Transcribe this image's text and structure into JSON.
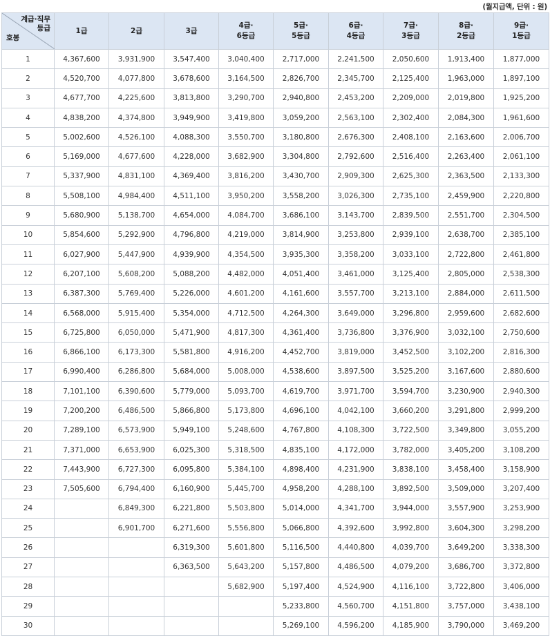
{
  "note": "(월지급액, 단위 : 원)",
  "corner": {
    "top_line1": "계급·직무",
    "top_line2": "등급",
    "bottom": "호봉"
  },
  "columns": [
    [
      "1급"
    ],
    [
      "2급"
    ],
    [
      "3급"
    ],
    [
      "4급·",
      "6등급"
    ],
    [
      "5급·",
      "5등급"
    ],
    [
      "6급·",
      "4등급"
    ],
    [
      "7급·",
      "3등급"
    ],
    [
      "8급·",
      "2등급"
    ],
    [
      "9급·",
      "1등급"
    ]
  ],
  "rows": [
    [
      "1",
      "4,367,600",
      "3,931,900",
      "3,547,400",
      "3,040,400",
      "2,717,000",
      "2,241,500",
      "2,050,600",
      "1,913,400",
      "1,877,000"
    ],
    [
      "2",
      "4,520,700",
      "4,077,800",
      "3,678,600",
      "3,164,500",
      "2,826,700",
      "2,345,700",
      "2,125,400",
      "1,963,000",
      "1,897,100"
    ],
    [
      "3",
      "4,677,700",
      "4,225,600",
      "3,813,800",
      "3,290,700",
      "2,940,800",
      "2,453,200",
      "2,209,000",
      "2,019,800",
      "1,925,200"
    ],
    [
      "4",
      "4,838,200",
      "4,374,800",
      "3,949,900",
      "3,419,800",
      "3,059,200",
      "2,563,100",
      "2,302,400",
      "2,084,300",
      "1,961,600"
    ],
    [
      "5",
      "5,002,600",
      "4,526,100",
      "4,088,300",
      "3,550,700",
      "3,180,800",
      "2,676,300",
      "2,408,100",
      "2,163,600",
      "2,006,700"
    ],
    [
      "6",
      "5,169,000",
      "4,677,600",
      "4,228,000",
      "3,682,900",
      "3,304,800",
      "2,792,600",
      "2,516,400",
      "2,263,400",
      "2,061,100"
    ],
    [
      "7",
      "5,337,900",
      "4,831,100",
      "4,369,400",
      "3,816,200",
      "3,430,700",
      "2,909,300",
      "2,625,300",
      "2,363,500",
      "2,133,300"
    ],
    [
      "8",
      "5,508,100",
      "4,984,400",
      "4,511,100",
      "3,950,200",
      "3,558,200",
      "3,026,300",
      "2,735,100",
      "2,459,900",
      "2,220,800"
    ],
    [
      "9",
      "5,680,900",
      "5,138,700",
      "4,654,000",
      "4,084,700",
      "3,686,100",
      "3,143,700",
      "2,839,500",
      "2,551,700",
      "2,304,500"
    ],
    [
      "10",
      "5,854,600",
      "5,292,900",
      "4,796,800",
      "4,219,000",
      "3,814,900",
      "3,253,800",
      "2,939,100",
      "2,638,700",
      "2,385,100"
    ],
    [
      "11",
      "6,027,900",
      "5,447,900",
      "4,939,900",
      "4,354,500",
      "3,935,300",
      "3,358,200",
      "3,033,100",
      "2,722,800",
      "2,461,800"
    ],
    [
      "12",
      "6,207,100",
      "5,608,200",
      "5,088,200",
      "4,482,000",
      "4,051,400",
      "3,461,000",
      "3,125,400",
      "2,805,000",
      "2,538,300"
    ],
    [
      "13",
      "6,387,300",
      "5,769,400",
      "5,226,000",
      "4,601,200",
      "4,161,600",
      "3,557,700",
      "3,213,100",
      "2,884,000",
      "2,611,500"
    ],
    [
      "14",
      "6,568,000",
      "5,915,400",
      "5,354,000",
      "4,712,500",
      "4,264,300",
      "3,649,000",
      "3,296,800",
      "2,959,600",
      "2,682,600"
    ],
    [
      "15",
      "6,725,800",
      "6,050,000",
      "5,471,900",
      "4,817,300",
      "4,361,400",
      "3,736,800",
      "3,376,900",
      "3,032,100",
      "2,750,600"
    ],
    [
      "16",
      "6,866,100",
      "6,173,300",
      "5,581,800",
      "4,916,200",
      "4,452,700",
      "3,819,000",
      "3,452,500",
      "3,102,200",
      "2,816,300"
    ],
    [
      "17",
      "6,990,400",
      "6,286,800",
      "5,684,000",
      "5,008,000",
      "4,538,600",
      "3,897,500",
      "3,525,200",
      "3,167,600",
      "2,880,600"
    ],
    [
      "18",
      "7,101,100",
      "6,390,600",
      "5,779,000",
      "5,093,700",
      "4,619,700",
      "3,971,700",
      "3,594,700",
      "3,230,900",
      "2,940,300"
    ],
    [
      "19",
      "7,200,200",
      "6,486,500",
      "5,866,800",
      "5,173,800",
      "4,696,100",
      "4,042,100",
      "3,660,200",
      "3,291,800",
      "2,999,200"
    ],
    [
      "20",
      "7,289,100",
      "6,573,900",
      "5,949,100",
      "5,248,600",
      "4,767,800",
      "4,108,300",
      "3,722,500",
      "3,349,800",
      "3,055,200"
    ],
    [
      "21",
      "7,371,000",
      "6,653,900",
      "6,025,300",
      "5,318,500",
      "4,835,100",
      "4,172,000",
      "3,782,000",
      "3,405,200",
      "3,108,200"
    ],
    [
      "22",
      "7,443,900",
      "6,727,300",
      "6,095,800",
      "5,384,100",
      "4,898,400",
      "4,231,900",
      "3,838,100",
      "3,458,400",
      "3,158,900"
    ],
    [
      "23",
      "7,505,600",
      "6,794,400",
      "6,160,900",
      "5,445,700",
      "4,958,200",
      "4,288,100",
      "3,892,500",
      "3,509,000",
      "3,207,400"
    ],
    [
      "24",
      "",
      "6,849,300",
      "6,221,800",
      "5,503,800",
      "5,014,000",
      "4,341,700",
      "3,944,000",
      "3,557,900",
      "3,253,900"
    ],
    [
      "25",
      "",
      "6,901,700",
      "6,271,600",
      "5,556,800",
      "5,066,800",
      "4,392,600",
      "3,992,800",
      "3,604,300",
      "3,298,200"
    ],
    [
      "26",
      "",
      "",
      "6,319,300",
      "5,601,800",
      "5,116,500",
      "4,440,800",
      "4,039,700",
      "3,649,200",
      "3,338,300"
    ],
    [
      "27",
      "",
      "",
      "6,363,500",
      "5,643,200",
      "5,157,800",
      "4,486,500",
      "4,079,200",
      "3,686,700",
      "3,372,800"
    ],
    [
      "28",
      "",
      "",
      "",
      "5,682,900",
      "5,197,400",
      "4,524,900",
      "4,116,100",
      "3,722,800",
      "3,406,000"
    ],
    [
      "29",
      "",
      "",
      "",
      "",
      "5,233,800",
      "4,560,700",
      "4,151,800",
      "3,757,000",
      "3,438,100"
    ],
    [
      "30",
      "",
      "",
      "",
      "",
      "5,269,100",
      "4,596,200",
      "4,185,900",
      "3,790,000",
      "3,469,200"
    ]
  ]
}
